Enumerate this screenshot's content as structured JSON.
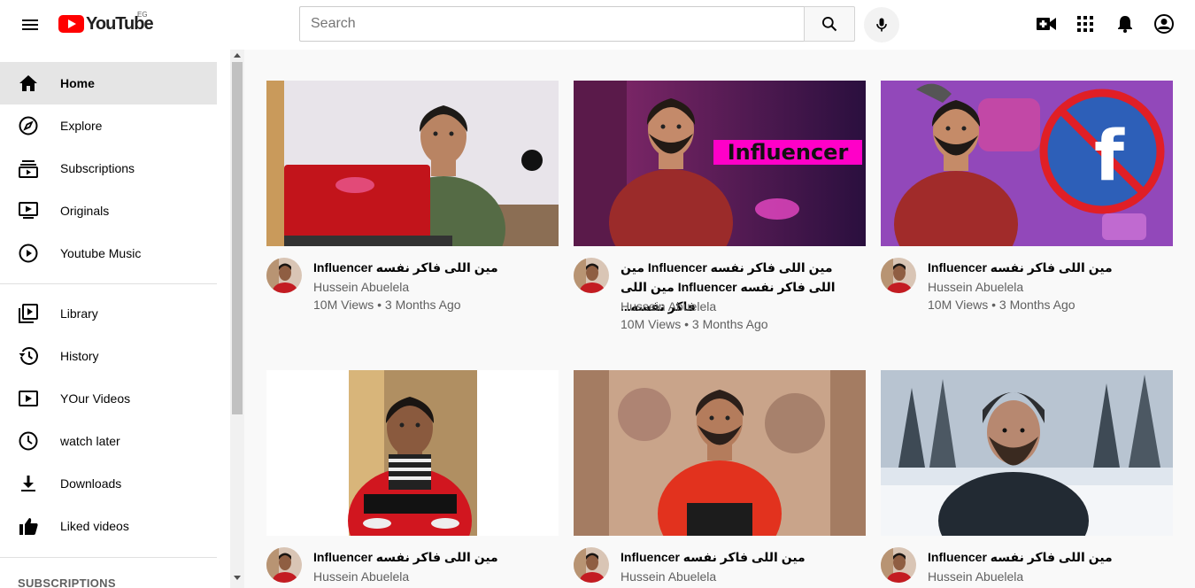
{
  "header": {
    "logo_text": "YouTube",
    "country_code": "EG",
    "search_placeholder": "Search"
  },
  "icons": {
    "menu": "hamburger-icon",
    "search": "search-icon",
    "mic": "microphone-icon",
    "create": "video-camera-plus-icon",
    "apps": "apps-grid-icon",
    "notifications": "bell-icon",
    "account": "account-circle-icon"
  },
  "sidebar": {
    "section1": [
      {
        "label": "Home",
        "icon": "home-icon",
        "active": true
      },
      {
        "label": "Explore",
        "icon": "compass-icon"
      },
      {
        "label": "Subscriptions",
        "icon": "subscriptions-icon"
      },
      {
        "label": "Originals",
        "icon": "originals-icon"
      },
      {
        "label": "Youtube Music",
        "icon": "play-circle-icon"
      }
    ],
    "section2": [
      {
        "label": "Library",
        "icon": "library-icon"
      },
      {
        "label": "History",
        "icon": "history-icon"
      },
      {
        "label": "YOur Videos",
        "icon": "your-videos-icon"
      },
      {
        "label": "watch later",
        "icon": "clock-icon"
      },
      {
        "label": "Downloads",
        "icon": "download-icon"
      },
      {
        "label": "Liked videos",
        "icon": "thumbs-up-icon"
      }
    ],
    "subscriptions_heading": "SUBSCRIPTIONS"
  },
  "videos": [
    {
      "title": "مين اللى فاكر نفسه Influencer",
      "channel": "Hussein Abuelela",
      "meta": "10M Views • 3 Months Ago"
    },
    {
      "title": "مين اللى فاكر نفسه Influencer مين اللى فاكر نفسه Influencer مين اللى فاكر نفسه...",
      "channel": "Hussein Abuelela",
      "meta": "10M Views • 3 Months Ago",
      "overlay_text": "Influencer"
    },
    {
      "title": "مين اللى فاكر نفسه Influencer",
      "channel": "Hussein Abuelela",
      "meta": "10M Views • 3 Months Ago"
    },
    {
      "title": "مين اللى فاكر نفسه Influencer",
      "channel": "Hussein Abuelela"
    },
    {
      "title": "مين اللى فاكر نفسه Influencer",
      "channel": "Hussein Abuelela"
    },
    {
      "title": "مين اللى فاكر نفسه Influencer",
      "channel": "Hussein Abuelela"
    }
  ],
  "colors": {
    "brand_red": "#ff0000",
    "overlay_magenta": "#ff00c8",
    "thumb_purple": "#6a1fa0"
  }
}
